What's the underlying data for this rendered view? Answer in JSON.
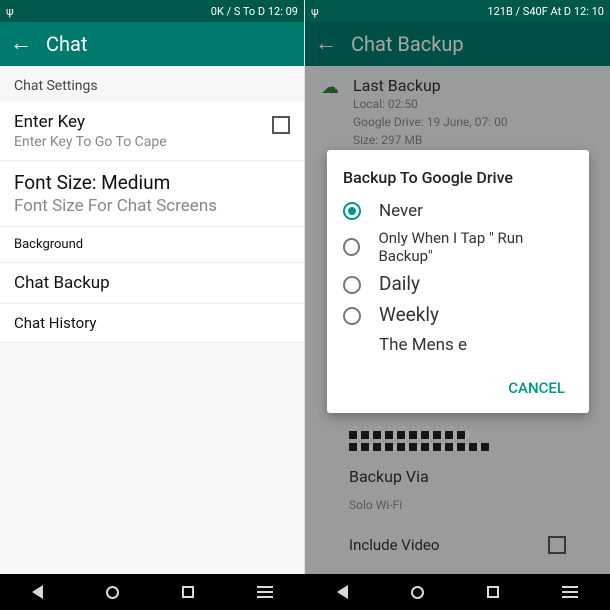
{
  "left": {
    "status": "0K / S To D 12: 09",
    "title": "Chat",
    "section": "Chat Settings",
    "enter_key": {
      "title": "Enter Key",
      "sub": "Enter Key To Go To Cape"
    },
    "font": {
      "title": "Font Size: Medium",
      "sub": "Font Size For Chat Screens"
    },
    "wallpaper": "Background",
    "backup": "Chat Backup",
    "history": "Chat History"
  },
  "right": {
    "status": "121B / S40F At D 12: 10",
    "title": "Chat Backup",
    "last_backup": {
      "heading": "Last Backup",
      "local": "Local: 02:50",
      "gdrive": "Google Drive: 19 June, 07: 00",
      "size": "Size: 297 MB"
    },
    "backup_via": {
      "title": "Backup Via",
      "sub": "Solo Wi-Fi"
    },
    "include_video": "Include Video",
    "dialog": {
      "title": "Backup To Google Drive",
      "opts": [
        "Never",
        "Only When I Tap \" Run Backup\"",
        "Daily",
        "Weekly",
        "The Mens e"
      ],
      "cancel": "CANCEL"
    }
  }
}
